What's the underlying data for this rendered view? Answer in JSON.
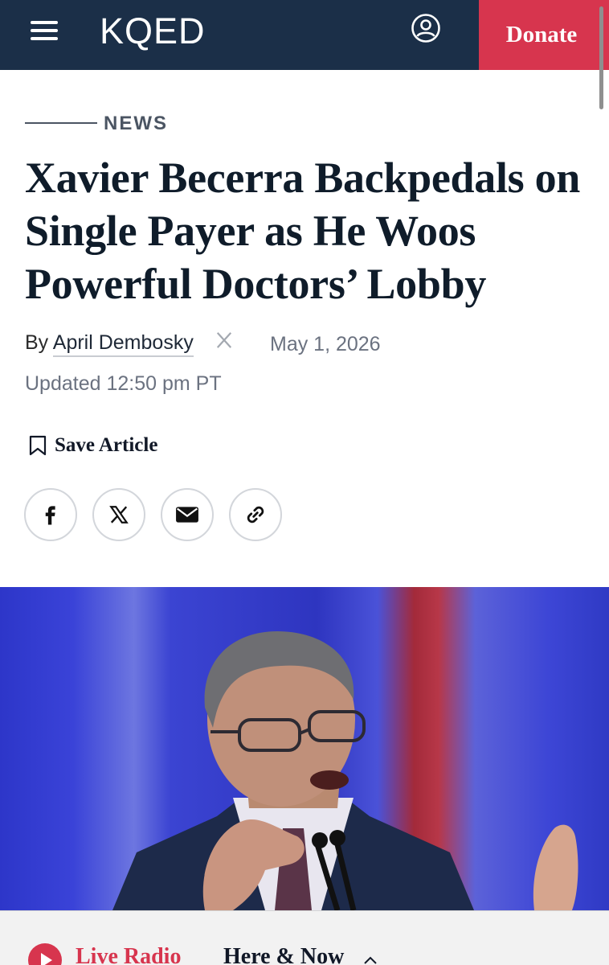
{
  "header": {
    "logo": "KQED",
    "donate_label": "Donate",
    "brand_color": "#1b2f48",
    "donate_color": "#d7354e",
    "icons": [
      "menu-icon",
      "account-icon"
    ]
  },
  "article": {
    "section": "NEWS",
    "headline": "Xavier Becerra Backpedals on Single Payer as He Woos Powerful Doctors’ Lobby",
    "byline_prefix": "By",
    "author": "April Dembosky",
    "author_social_icon": "x-icon",
    "date": "May 1, 2026",
    "updated": "Updated 12:50 pm PT",
    "save_label": "Save Article",
    "share_icons": [
      "facebook-icon",
      "x-icon",
      "email-icon",
      "link-icon"
    ]
  },
  "hero": {
    "icon": "photo-of-speaker"
  },
  "radio_bar": {
    "live_label": "Live Radio",
    "program": "Here & Now",
    "icons": [
      "play-icon",
      "chevron-up-icon"
    ]
  }
}
